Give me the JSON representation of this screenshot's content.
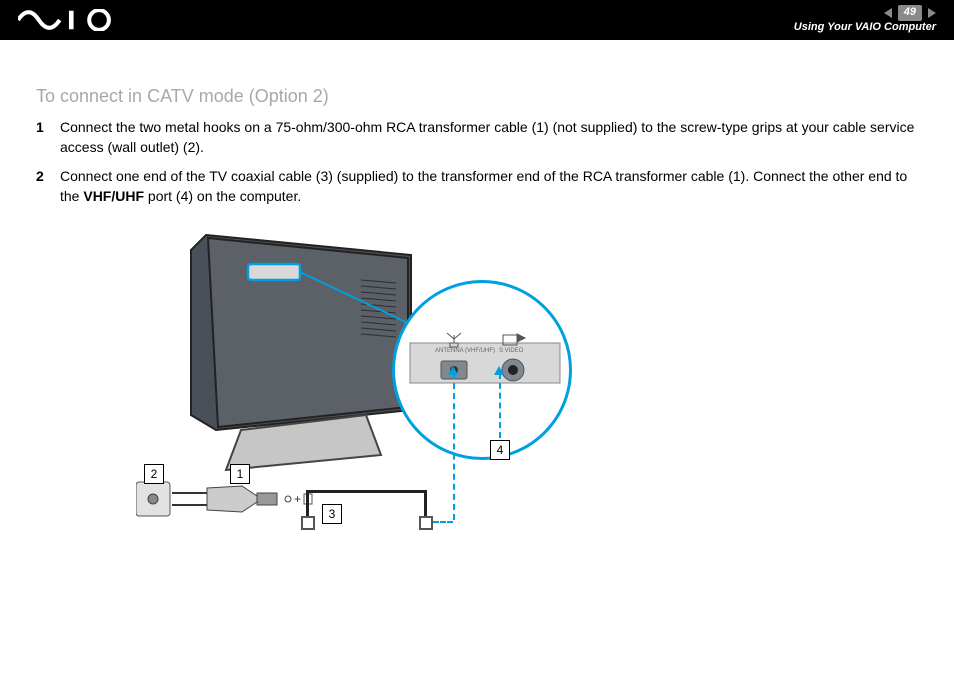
{
  "header": {
    "brand": "VAIO",
    "page_number": "49",
    "section": "Using Your VAIO Computer"
  },
  "title": "To connect in CATV mode (Option 2)",
  "steps": {
    "s1_a": "Connect the two metal hooks on a 75-ohm/300-ohm RCA transformer cable (1) (not supplied) to the screw-type grips at your cable service access (wall outlet) (2).",
    "s2_a": "Connect one end of the TV coaxial cable (3) (supplied) to the transformer end of the RCA transformer cable (1). Connect the other end to the ",
    "s2_bold": "VHF/UHF",
    "s2_b": " port (4) on the computer."
  },
  "callouts": {
    "c1": "1",
    "c2": "2",
    "c3": "3",
    "c4": "4"
  },
  "zoom_labels": {
    "antenna": "ANTENNA (VHF/UHF)",
    "svideo": "S VIDEO"
  }
}
